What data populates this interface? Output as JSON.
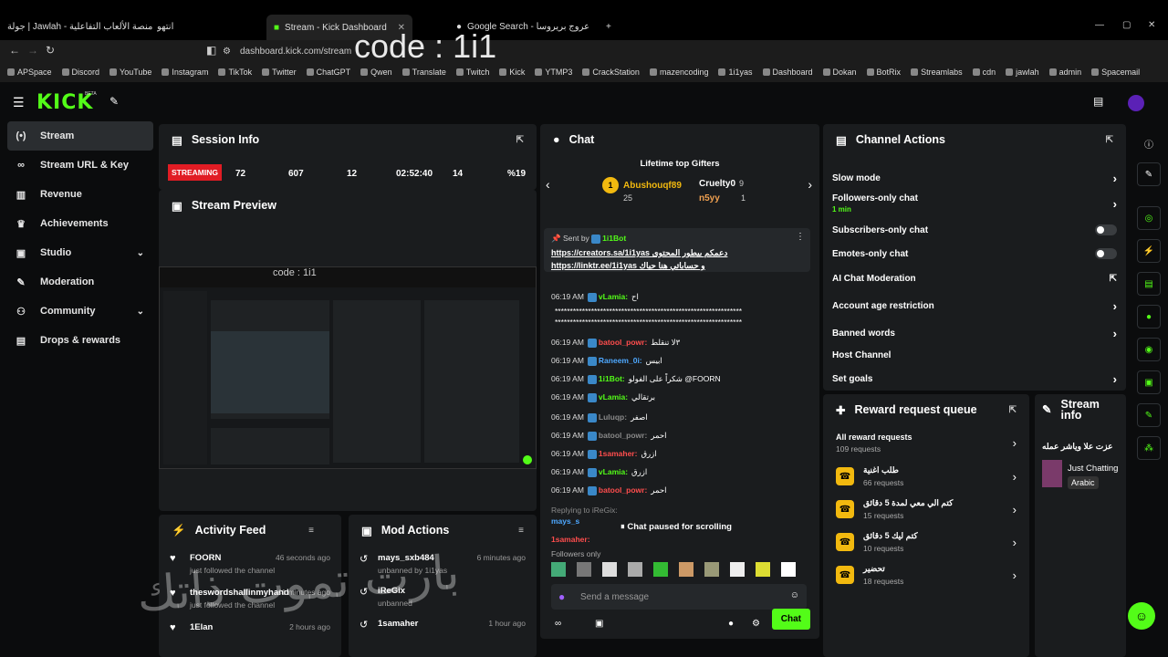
{
  "browser": {
    "tabs": [
      {
        "label": "جولة | Jawlah - منصة الألعاب التفاعلية"
      },
      {
        "label": "انتهو"
      },
      {
        "label": "Stream - Kick Dashboard"
      },
      {
        "label": "Google Search - عروج بريروسا"
      }
    ],
    "url": "dashboard.kick.com/stream",
    "overlay_text": "code : 1i1",
    "bookmarks": [
      "APSpace",
      "Discord",
      "YouTube",
      "Instagram",
      "TikTok",
      "Twitter",
      "ChatGPT",
      "Qwen",
      "Translate",
      "Twitch",
      "Kick",
      "YTMP3",
      "CrackStation",
      "mazencoding",
      "1i1yas",
      "Dashboard",
      "Dokan",
      "BotRix",
      "Streamlabs",
      "cdn",
      "jawlah",
      "admin",
      "Spacemail"
    ]
  },
  "brand": {
    "logo": "KICK",
    "beta": "BETA",
    "accent": "#53fc18"
  },
  "sidebar": {
    "items": [
      {
        "label": "Stream",
        "icon": "radio-icon",
        "active": true
      },
      {
        "label": "Stream URL & Key",
        "icon": "link-icon"
      },
      {
        "label": "Revenue",
        "icon": "chart-icon"
      },
      {
        "label": "Achievements",
        "icon": "trophy-icon"
      },
      {
        "label": "Studio",
        "icon": "video-icon",
        "chevron": true
      },
      {
        "label": "Moderation",
        "icon": "wrench-icon"
      },
      {
        "label": "Community",
        "icon": "users-icon",
        "chevron": true
      },
      {
        "label": "Drops & rewards",
        "icon": "gift-icon"
      }
    ]
  },
  "session": {
    "title": "Session Info",
    "status": "STREAMING",
    "stats": [
      "72",
      "607",
      "12",
      "02:52:40",
      "14",
      "%19"
    ]
  },
  "preview": {
    "title": "Stream Preview",
    "overlay": "code : 1i1"
  },
  "activity": {
    "title": "Activity Feed",
    "items": [
      {
        "name": "FOORN",
        "sub": "just followed the channel",
        "time": "46 seconds ago"
      },
      {
        "name": "theswordshallinmyhand",
        "sub": "just followed the channel",
        "time": "41 minutes ago"
      },
      {
        "name": "1Elan",
        "sub": "",
        "time": "2 hours ago"
      }
    ]
  },
  "mod": {
    "title": "Mod Actions",
    "items": [
      {
        "name": "mays_sxb484",
        "sub": "unbanned by 1i1yas",
        "time": "6 minutes ago"
      },
      {
        "name": "iReGix",
        "sub": "unbanned",
        "time": ""
      },
      {
        "name": "1samaher",
        "sub": "",
        "time": "1 hour ago"
      }
    ]
  },
  "chat": {
    "title": "Chat",
    "gifters_title": "Lifetime top Gifters",
    "gifters": [
      {
        "name": "Abushouqf89",
        "count": "25",
        "rank": "1"
      },
      {
        "name": "Cruelty0",
        "count": "9"
      },
      {
        "name": "n5yy",
        "count": "1"
      }
    ],
    "pinned": {
      "by": "Sent by",
      "bot": "1i1Bot",
      "line1": "https://creators.sa/1i1yas دعمكم بيطور المحتوى",
      "line2": "https://linktr.ee/1i1yas و حساباتي هنا حياك"
    },
    "messages": [
      {
        "time": "06:19 AM",
        "user": "vLamia:",
        "text": "اح",
        "ucolor": "#53fc18"
      },
      {
        "time": "",
        "user": "",
        "text": "**************************************************************",
        "ucolor": "#fff"
      },
      {
        "time": "",
        "user": "",
        "text": "**************************************************************",
        "ucolor": "#fff"
      },
      {
        "time": "06:19 AM",
        "user": "batool_powr:",
        "text": "٣لا تنقلط",
        "ucolor": "#ff4d4d"
      },
      {
        "time": "06:19 AM",
        "user": "Raneem_0i:",
        "text": "ابيس",
        "ucolor": "#4ea8ff"
      },
      {
        "time": "06:19 AM",
        "user": "1i1Bot:",
        "text": "شكراً على الفولو @FOORN",
        "ucolor": "#53fc18"
      },
      {
        "time": "06:19 AM",
        "user": "vLamia:",
        "text": "برتقالي",
        "ucolor": "#53fc18"
      },
      {
        "time": "06:19 AM",
        "user": "Luluqp:",
        "text": "اصفر",
        "ucolor": "#888"
      },
      {
        "time": "06:19 AM",
        "user": "batool_powr:",
        "text": "احمر",
        "ucolor": "#888"
      },
      {
        "time": "06:19 AM",
        "user": "1samaher:",
        "text": "ازرق",
        "ucolor": "#ff4d4d"
      },
      {
        "time": "06:19 AM",
        "user": "vLamia:",
        "text": "ازرق",
        "ucolor": "#53fc18"
      },
      {
        "time": "06:19 AM",
        "user": "batool_powr:",
        "text": "احمر",
        "ucolor": "#ff4d4d"
      }
    ],
    "reply": "Replying to iReGix:",
    "mays": "mays_s",
    "samaher": "1samaher:",
    "paused": "Chat paused for scrolling",
    "followers_only": "Followers only",
    "placeholder": "Send a message",
    "send": "Chat"
  },
  "actions": {
    "title": "Channel Actions",
    "items": [
      {
        "label": "Slow mode",
        "type": "chev"
      },
      {
        "label": "Followers-only chat",
        "sub": "1 min",
        "type": "chev"
      },
      {
        "label": "Subscribers-only chat",
        "type": "toggle"
      },
      {
        "label": "Emotes-only chat",
        "type": "toggle"
      },
      {
        "label": "AI Chat Moderation",
        "type": "ext"
      },
      {
        "label": "Account age restriction",
        "type": "chev"
      },
      {
        "label": "Banned words",
        "type": "chev"
      },
      {
        "label": "Host Channel",
        "type": "none"
      },
      {
        "label": "Set goals",
        "type": "chev"
      }
    ]
  },
  "rewards": {
    "title": "Reward request queue",
    "items": [
      {
        "label": "All reward requests",
        "sub": "109 requests"
      },
      {
        "label": "طلب اغنية",
        "sub": "66 requests"
      },
      {
        "label": "كتم الي معي لمدة 5 دقائق",
        "sub": "15 requests"
      },
      {
        "label": "كتم ليك 5 دقائق",
        "sub": "10 requests"
      },
      {
        "label": "تحضير",
        "sub": "18 requests"
      }
    ]
  },
  "streaminfo": {
    "title": "Stream info",
    "stream_title": "عزت علا وياشر عمله",
    "category": "Just Chatting",
    "tag": "Arabic"
  },
  "watermark": "بارت تموت ذاتك"
}
